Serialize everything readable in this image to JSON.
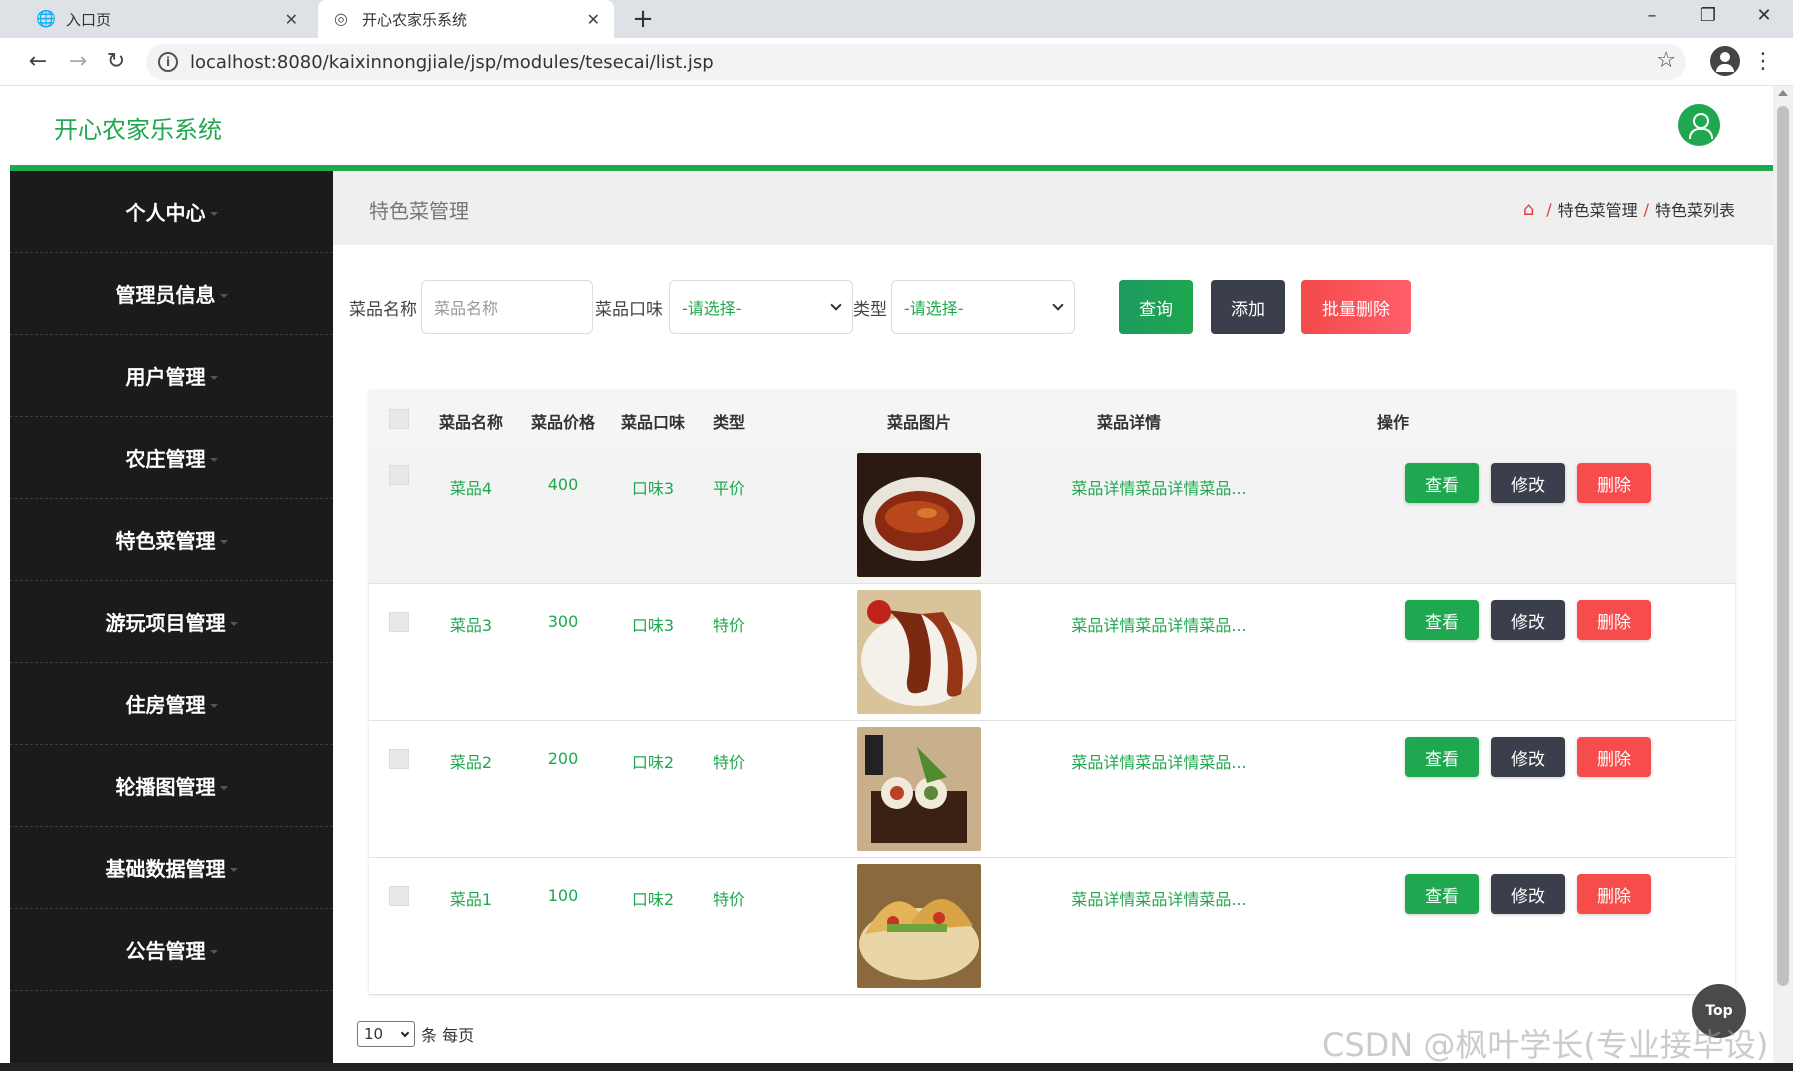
{
  "browser": {
    "tabs": [
      {
        "label": "入口页",
        "icon": "globe-icon"
      },
      {
        "label": "开心农家乐系统",
        "icon": "site-icon"
      }
    ],
    "url": "localhost:8080/kaixinnongjiale/jsp/modules/tesecai/list.jsp"
  },
  "app": {
    "title": "开心农家乐系统"
  },
  "sidebar": {
    "items": [
      {
        "label": "个人中心"
      },
      {
        "label": "管理员信息"
      },
      {
        "label": "用户管理"
      },
      {
        "label": "农庄管理"
      },
      {
        "label": "特色菜管理"
      },
      {
        "label": "游玩项目管理"
      },
      {
        "label": "住房管理"
      },
      {
        "label": "轮播图管理"
      },
      {
        "label": "基础数据管理"
      },
      {
        "label": "公告管理"
      }
    ]
  },
  "page": {
    "title": "特色菜管理",
    "breadcrumb": [
      "特色菜管理",
      "特色菜列表"
    ],
    "separator": "/"
  },
  "filter": {
    "name_label": "菜品名称",
    "name_placeholder": "菜品名称",
    "taste_label": "菜品口味",
    "taste_value": "-请选择-",
    "type_label": "类型",
    "type_value": "-请选择-",
    "query_button": "查询",
    "add_button": "添加",
    "batch_delete_button": "批量删除"
  },
  "table": {
    "headers": [
      "菜品名称",
      "菜品价格",
      "菜品口味",
      "类型",
      "菜品图片",
      "菜品详情",
      "操作"
    ],
    "rows": [
      {
        "name": "菜品4",
        "price": "400",
        "taste": "口味3",
        "type": "平价",
        "detail": "菜品详情菜品详情菜品..."
      },
      {
        "name": "菜品3",
        "price": "300",
        "taste": "口味3",
        "type": "特价",
        "detail": "菜品详情菜品详情菜品..."
      },
      {
        "name": "菜品2",
        "price": "200",
        "taste": "口味2",
        "type": "特价",
        "detail": "菜品详情菜品详情菜品..."
      },
      {
        "name": "菜品1",
        "price": "100",
        "taste": "口味2",
        "type": "特价",
        "detail": "菜品详情菜品详情菜品..."
      }
    ],
    "actions": {
      "view": "查看",
      "edit": "修改",
      "delete": "删除"
    }
  },
  "pager": {
    "page_size": "10",
    "suffix": "条 每页"
  },
  "top_button": "Top",
  "watermark": "CSDN @枫叶学长(专业接毕设)",
  "colors": {
    "primary": "#1fa84f",
    "dark": "#3a3f4b",
    "danger": "#f64c4c",
    "sidebar": "#1b1b1b"
  }
}
